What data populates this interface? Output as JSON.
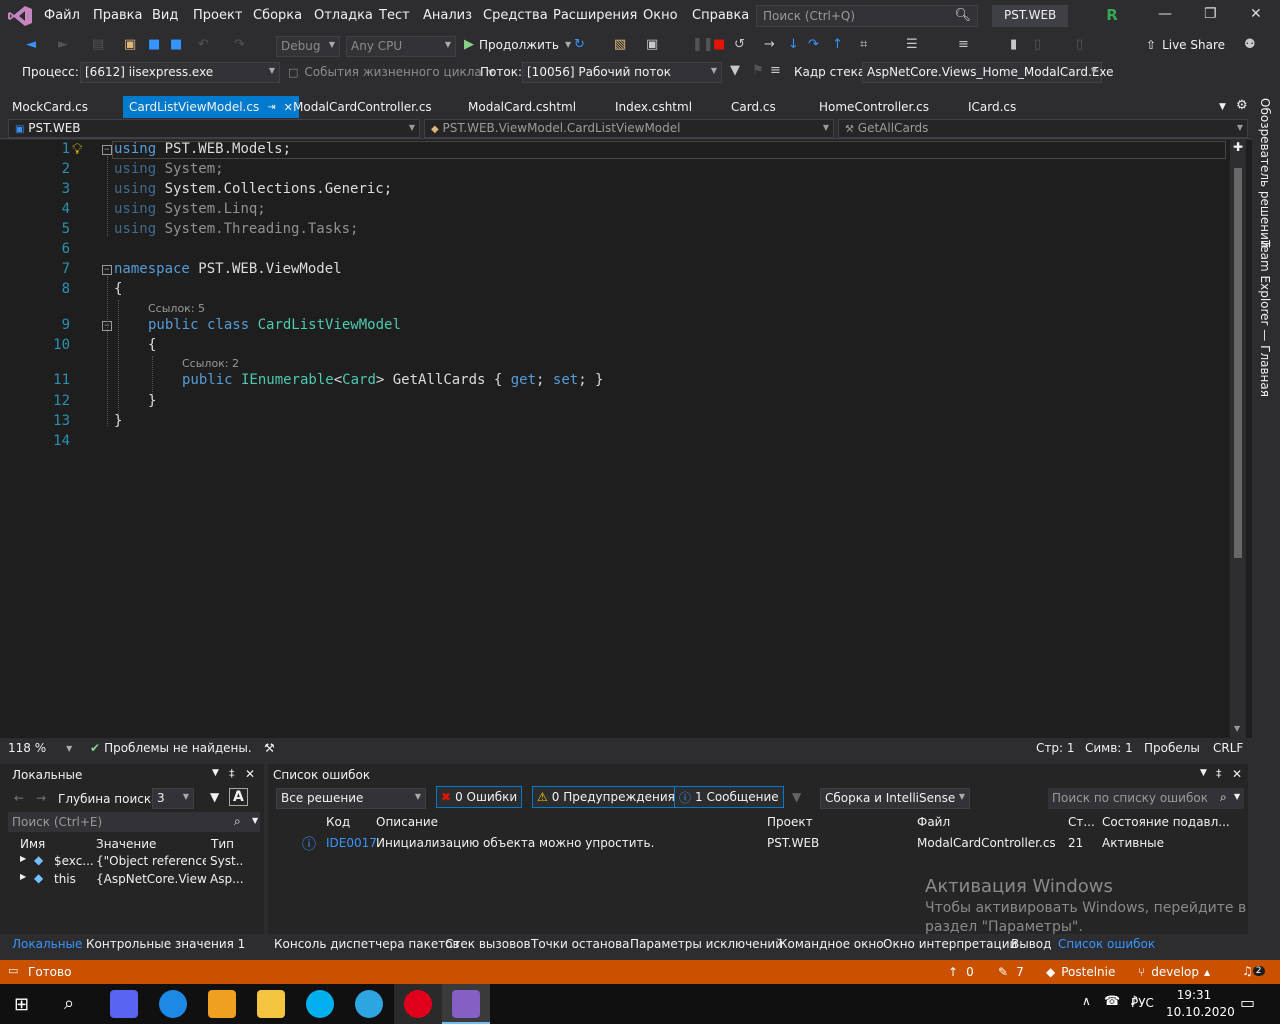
{
  "menu": {
    "items": [
      "Файл",
      "Правка",
      "Вид",
      "Проект",
      "Сборка",
      "Отладка",
      "Тест",
      "Анализ",
      "Средства",
      "Расширения",
      "Окно",
      "Справка"
    ],
    "search_placeholder": "Поиск (Ctrl+Q)",
    "solution": "PST.WEB",
    "avatar_letter": "R"
  },
  "toolbar": {
    "config": "Debug",
    "platform": "Any CPU",
    "continue_label": "Продолжить",
    "live_share": "Live Share"
  },
  "debugbar": {
    "process_label": "Процесс:",
    "process_value": "[6612] iisexpress.exe",
    "lifecycle": "События жизненного цикла",
    "thread_label": "Поток:",
    "thread_value": "[10056] Рабочий поток",
    "stack_label": "Кадр стека:",
    "stack_value": "AspNetCore.Views_Home_ModalCard.Exe"
  },
  "tabs": [
    "MockCard.cs",
    "CardListViewModel.cs",
    "ModalCardController.cs",
    "ModalCard.cshtml",
    "Index.cshtml",
    "Card.cs",
    "HomeController.cs",
    "ICard.cs"
  ],
  "active_tab": "CardListViewModel.cs",
  "navbar": {
    "project": "PST.WEB",
    "type": "PST.WEB.ViewModel.CardListViewModel",
    "member": "GetAllCards"
  },
  "code": {
    "line_numbers": [
      "1",
      "2",
      "3",
      "4",
      "5",
      "6",
      "7",
      "8",
      "9",
      "10",
      "11",
      "12",
      "13",
      "14"
    ],
    "l1_kw": "using",
    "l1_rest": " PST.WEB.Models;",
    "l2_kw": "using",
    "l2_rest": " System;",
    "l3_kw": "using",
    "l3_rest": " System.Collections.Generic;",
    "l4_kw": "using",
    "l4_rest": " System.Linq;",
    "l5_kw": "using",
    "l5_rest": " System.Threading.Tasks;",
    "l7_kw": "namespace",
    "l7_rest": " PST.WEB.ViewModel",
    "l8": "{",
    "lens_class": "Ссылок: 5",
    "l9_kw": "public class",
    "l9_type": " CardListViewModel",
    "l10": "{",
    "lens_prop": "Ссылок: 2",
    "l11_kw": "public",
    "l11_type": " IEnumerable",
    "l11_lt": "<",
    "l11_card": "Card",
    "l11_rest": "> GetAllCards { ",
    "l11_get": "get",
    "l11_semi1": "; ",
    "l11_set": "set",
    "l11_end": "; }",
    "l12": "}",
    "l13": "}"
  },
  "editor_status": {
    "zoom": "118 %",
    "problems": "Проблемы не найдены.",
    "line": "Стр: 1",
    "col": "Симв: 1",
    "spaces": "Пробелы",
    "eol": "CRLF"
  },
  "right_panel": {
    "solution_explorer": "Обозреватель решений",
    "team_explorer": "Team Explorer — Главная"
  },
  "locals": {
    "title": "Локальные",
    "depth_label": "Глубина поиска:",
    "depth_value": "3",
    "search_placeholder": "Поиск (Ctrl+E)",
    "columns": [
      "Имя",
      "Значение",
      "Тип"
    ],
    "rows": [
      {
        "name": "$exc...",
        "value": "{\"Object reference ...",
        "type": "Syst..."
      },
      {
        "name": "this",
        "value": "{AspNetCore.View...",
        "type": "Asp..."
      }
    ]
  },
  "errors": {
    "title": "Список ошибок",
    "scope": "Все решение",
    "errors_btn": "0 Ошибки",
    "warnings_btn": "0 Предупреждения",
    "messages_btn": "1 Сообщение",
    "build_filter": "Сборка и IntelliSense",
    "search_placeholder": "Поиск по списку ошибок",
    "columns": [
      "Код",
      "Описание",
      "Проект",
      "Файл",
      "Ст...",
      "Состояние подавл..."
    ],
    "rows": [
      {
        "code": "IDE0017",
        "description": "Инициализацию объекта можно упростить.",
        "project": "PST.WEB",
        "file": "ModalCardController.cs",
        "line": "21",
        "state": "Активные"
      }
    ]
  },
  "watermark": {
    "title": "Активация Windows",
    "line1": "Чтобы активировать Windows, перейдите в",
    "line2": "раздел \"Параметры\"."
  },
  "bottom_tabs": {
    "left": [
      "Локальные",
      "Контрольные значения 1"
    ],
    "right": [
      "Консоль диспетчера пакетов",
      "Стек вызовов",
      "Точки останова",
      "Параметры исключений",
      "Командное окно",
      "Окно интерпретации",
      "Вывод",
      "Список ошибок"
    ]
  },
  "statusbar": {
    "ready": "Готово",
    "up_count": "0",
    "pencil_count": "7",
    "repo": "Postelnie",
    "branch": "develop",
    "notif": "2"
  },
  "taskbar": {
    "lang": "РУС",
    "time": "19:31",
    "date": "10.10.2020"
  },
  "colors": {
    "accent": "#007acc",
    "status": "#ca5100",
    "keyword": "#569cd6",
    "type": "#4ec9b0",
    "line_number": "#2b91af"
  }
}
